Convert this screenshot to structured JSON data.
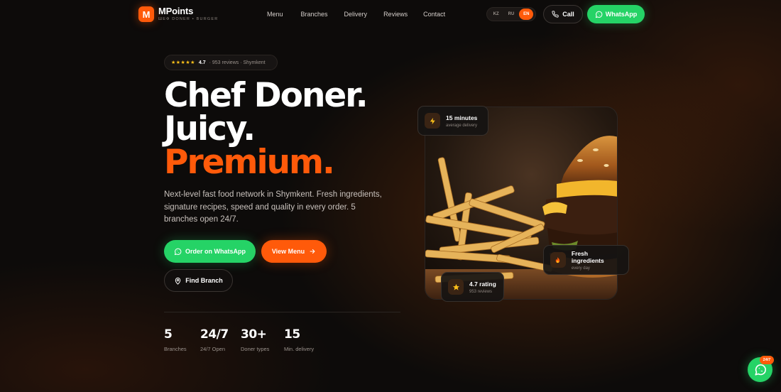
{
  "brand": {
    "mark": "M",
    "name": "MPoints",
    "tagline": "ШЕФ DONER • BURGER"
  },
  "nav": {
    "links": [
      "Menu",
      "Branches",
      "Delivery",
      "Reviews",
      "Contact"
    ],
    "languages": [
      "KZ",
      "RU",
      "EN"
    ],
    "active_language": "EN",
    "call_label": "Call",
    "whatsapp_label": "WhatsApp"
  },
  "hero": {
    "badge": {
      "stars": "★★★★★",
      "rating": "4.7",
      "reviews": "· 953 reviews · Shymkent"
    },
    "headline": {
      "line1": "Chef Doner.",
      "line2": "Juicy.",
      "line3": "Premium."
    },
    "description": "Next-level fast food network in Shymkent. Fresh ingredients, signature recipes, speed and quality in every order. 5 branches open 24/7.",
    "buttons": {
      "order": "Order on WhatsApp",
      "menu": "View Menu",
      "find": "Find Branch"
    },
    "stats": [
      {
        "value": "5",
        "label": "Branches"
      },
      {
        "value": "24/7",
        "label": "24/7 Open"
      },
      {
        "value": "30+",
        "label": "Doner types"
      },
      {
        "value": "15",
        "label": "Min. delivery"
      }
    ]
  },
  "cards": {
    "delivery": {
      "title": "15 minutes",
      "sub": "average delivery"
    },
    "fresh": {
      "title": "Fresh ingredients",
      "sub": "every day"
    },
    "rating": {
      "title": "4.7 rating",
      "sub": "953 reviews"
    }
  },
  "floating": {
    "badge": "24/7"
  },
  "colors": {
    "accent": "#ff5a0a",
    "whatsapp": "#25d366",
    "background": "#0d0b0a",
    "stars": "#ffc21a"
  },
  "icons": {
    "call": "phone-icon",
    "whatsapp": "whatsapp-icon",
    "menu_arrow": "arrow-right-icon",
    "find": "map-pin-icon",
    "delivery": "lightning-icon",
    "fresh": "fire-icon",
    "rating": "star-icon"
  }
}
